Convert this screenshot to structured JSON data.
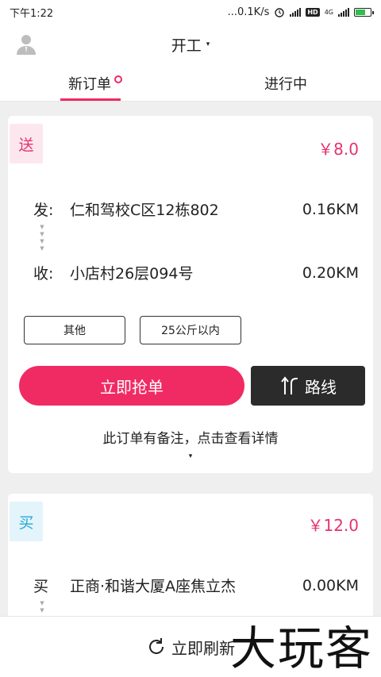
{
  "status_bar": {
    "time": "下午1:22",
    "network_speed": "...0.1K/s",
    "hd": "HD",
    "net_type": "4G"
  },
  "header": {
    "title": "开工",
    "title_caret": "▾"
  },
  "tabs": [
    {
      "label": "新订单",
      "active": true
    },
    {
      "label": "进行中",
      "active": false
    }
  ],
  "orders": [
    {
      "type": "送",
      "price": "￥8.0",
      "from_label": "发:",
      "from_address": "仁和驾校C区12栋802",
      "from_distance": "0.16KM",
      "to_label": "收:",
      "to_address": "小店村26层094号",
      "to_distance": "0.20KM",
      "tags": [
        "其他",
        "25公斤以内"
      ],
      "grab_label": "立即抢单",
      "route_label": "路线",
      "remark": "此订单有备注，点击查看详情",
      "remark_caret": "▾"
    },
    {
      "type": "买",
      "price": "￥12.0",
      "buy_label": "买",
      "buy_address": "正商·和谐大厦A座焦立杰",
      "buy_distance": "0.00KM"
    }
  ],
  "bottom": {
    "refresh_label": "立即刷新"
  },
  "watermark": "大玩客",
  "colors": {
    "accent": "#ef2a63",
    "dark_button": "#2b2b2b",
    "buy_badge": "#27a8d8"
  }
}
